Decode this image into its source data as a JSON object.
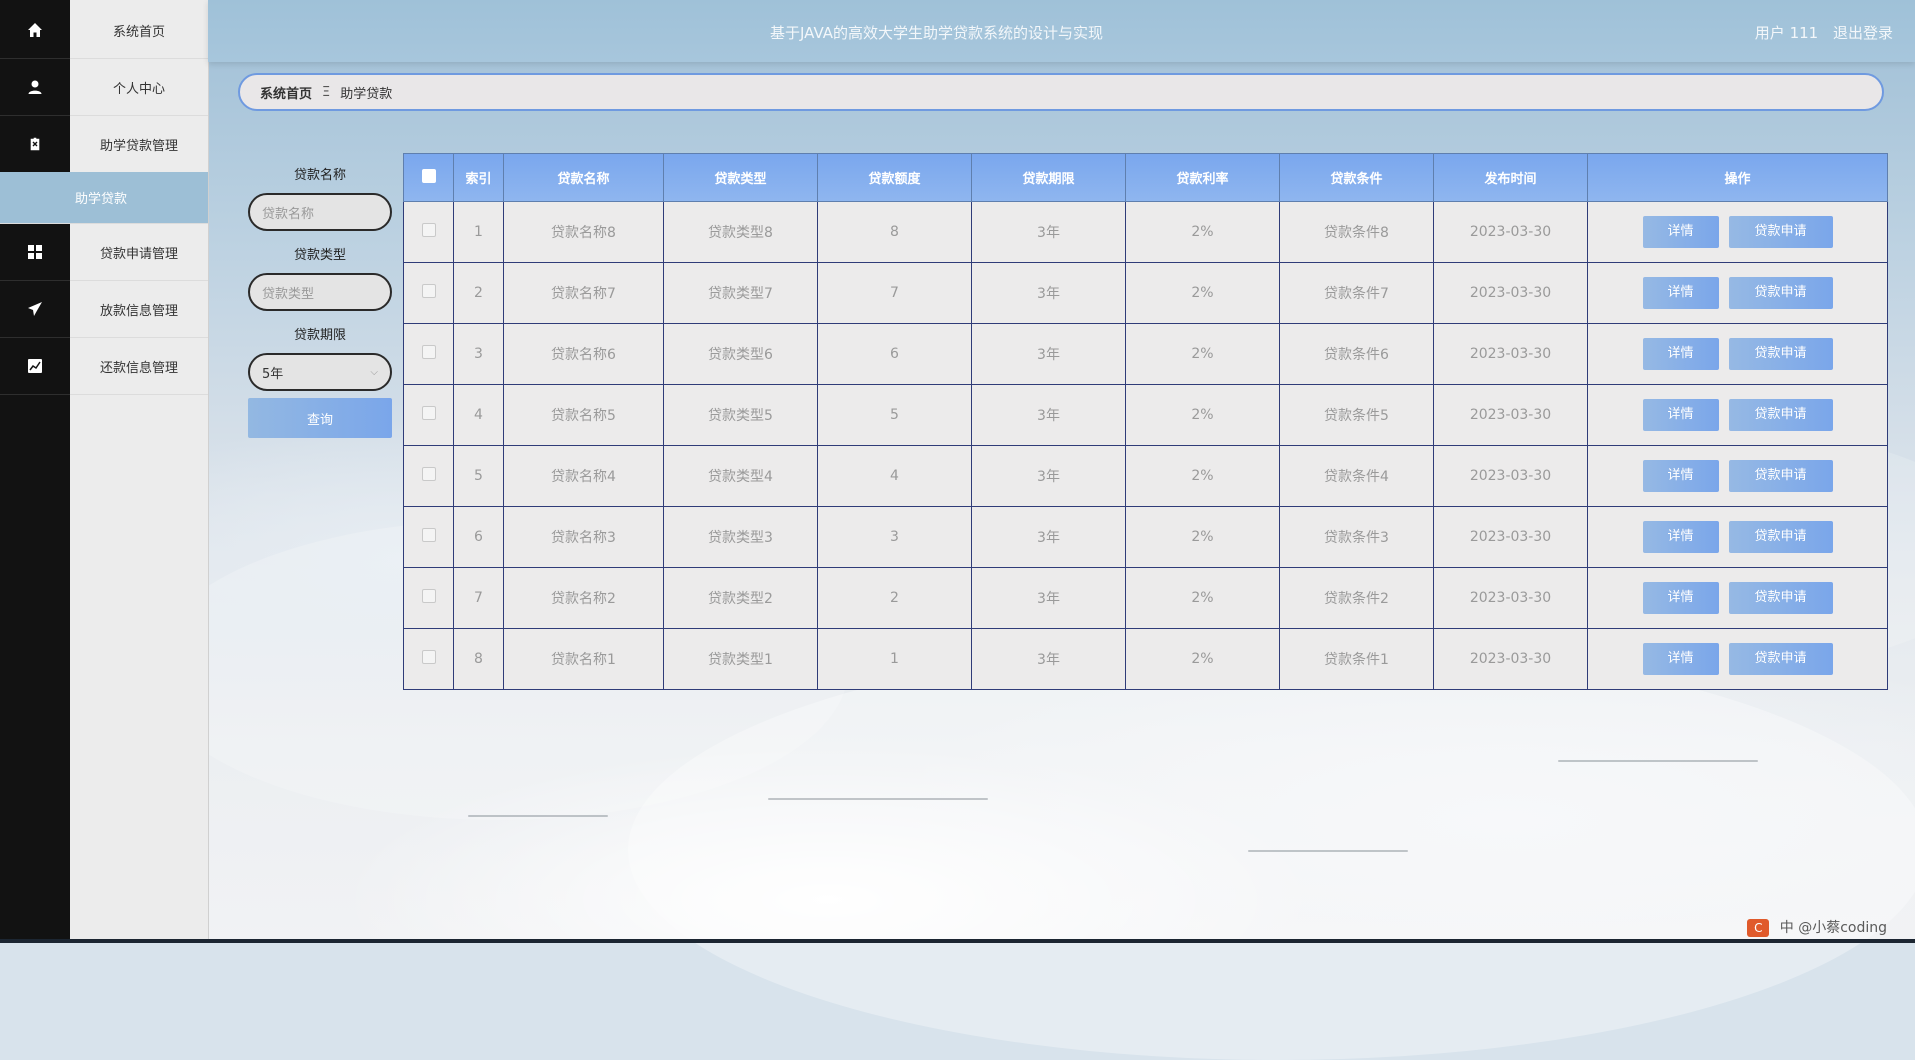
{
  "app": {
    "title": "基于JAVA的高效大学生助学贷款系统的设计与实现",
    "user_label": "用户 111",
    "logout_label": "退出登录"
  },
  "sidebar": {
    "items": [
      {
        "label": "系统首页",
        "icon": "home-icon"
      },
      {
        "label": "个人中心",
        "icon": "user-icon"
      },
      {
        "label": "助学贷款管理",
        "icon": "clipboard-icon"
      },
      {
        "label": "助学贷款",
        "icon": "",
        "active": true
      },
      {
        "label": "贷款申请管理",
        "icon": "grid-icon"
      },
      {
        "label": "放款信息管理",
        "icon": "send-icon"
      },
      {
        "label": "还款信息管理",
        "icon": "chart-icon"
      }
    ]
  },
  "breadcrumb": {
    "home": "系统首页",
    "separator": "Ξ",
    "current": "助学贷款"
  },
  "search": {
    "name_label": "贷款名称",
    "name_placeholder": "贷款名称",
    "type_label": "贷款类型",
    "type_placeholder": "贷款类型",
    "term_label": "贷款期限",
    "term_value": "5年",
    "query_label": "查询"
  },
  "table": {
    "headers": [
      "索引",
      "贷款名称",
      "贷款类型",
      "贷款额度",
      "贷款期限",
      "贷款利率",
      "贷款条件",
      "发布时间",
      "操作"
    ],
    "rows": [
      {
        "index": "1",
        "name": "贷款名称8",
        "type": "贷款类型8",
        "amount": "8",
        "term": "3年",
        "rate": "2%",
        "condition": "贷款条件8",
        "date": "2023-03-30"
      },
      {
        "index": "2",
        "name": "贷款名称7",
        "type": "贷款类型7",
        "amount": "7",
        "term": "3年",
        "rate": "2%",
        "condition": "贷款条件7",
        "date": "2023-03-30"
      },
      {
        "index": "3",
        "name": "贷款名称6",
        "type": "贷款类型6",
        "amount": "6",
        "term": "3年",
        "rate": "2%",
        "condition": "贷款条件6",
        "date": "2023-03-30"
      },
      {
        "index": "4",
        "name": "贷款名称5",
        "type": "贷款类型5",
        "amount": "5",
        "term": "3年",
        "rate": "2%",
        "condition": "贷款条件5",
        "date": "2023-03-30"
      },
      {
        "index": "5",
        "name": "贷款名称4",
        "type": "贷款类型4",
        "amount": "4",
        "term": "3年",
        "rate": "2%",
        "condition": "贷款条件4",
        "date": "2023-03-30"
      },
      {
        "index": "6",
        "name": "贷款名称3",
        "type": "贷款类型3",
        "amount": "3",
        "term": "3年",
        "rate": "2%",
        "condition": "贷款条件3",
        "date": "2023-03-30"
      },
      {
        "index": "7",
        "name": "贷款名称2",
        "type": "贷款类型2",
        "amount": "2",
        "term": "3年",
        "rate": "2%",
        "condition": "贷款条件2",
        "date": "2023-03-30"
      },
      {
        "index": "8",
        "name": "贷款名称1",
        "type": "贷款类型1",
        "amount": "1",
        "term": "3年",
        "rate": "2%",
        "condition": "贷款条件1",
        "date": "2023-03-30"
      }
    ],
    "detail_label": "详情",
    "apply_label": "贷款申请"
  },
  "watermark": {
    "logo": "C",
    "text": "中 @小蔡coding"
  },
  "colors": {
    "accent": "#7aa6ea",
    "topbar": "#a0c2d9",
    "rail": "#121212",
    "active_menu": "#9dbfd6"
  }
}
